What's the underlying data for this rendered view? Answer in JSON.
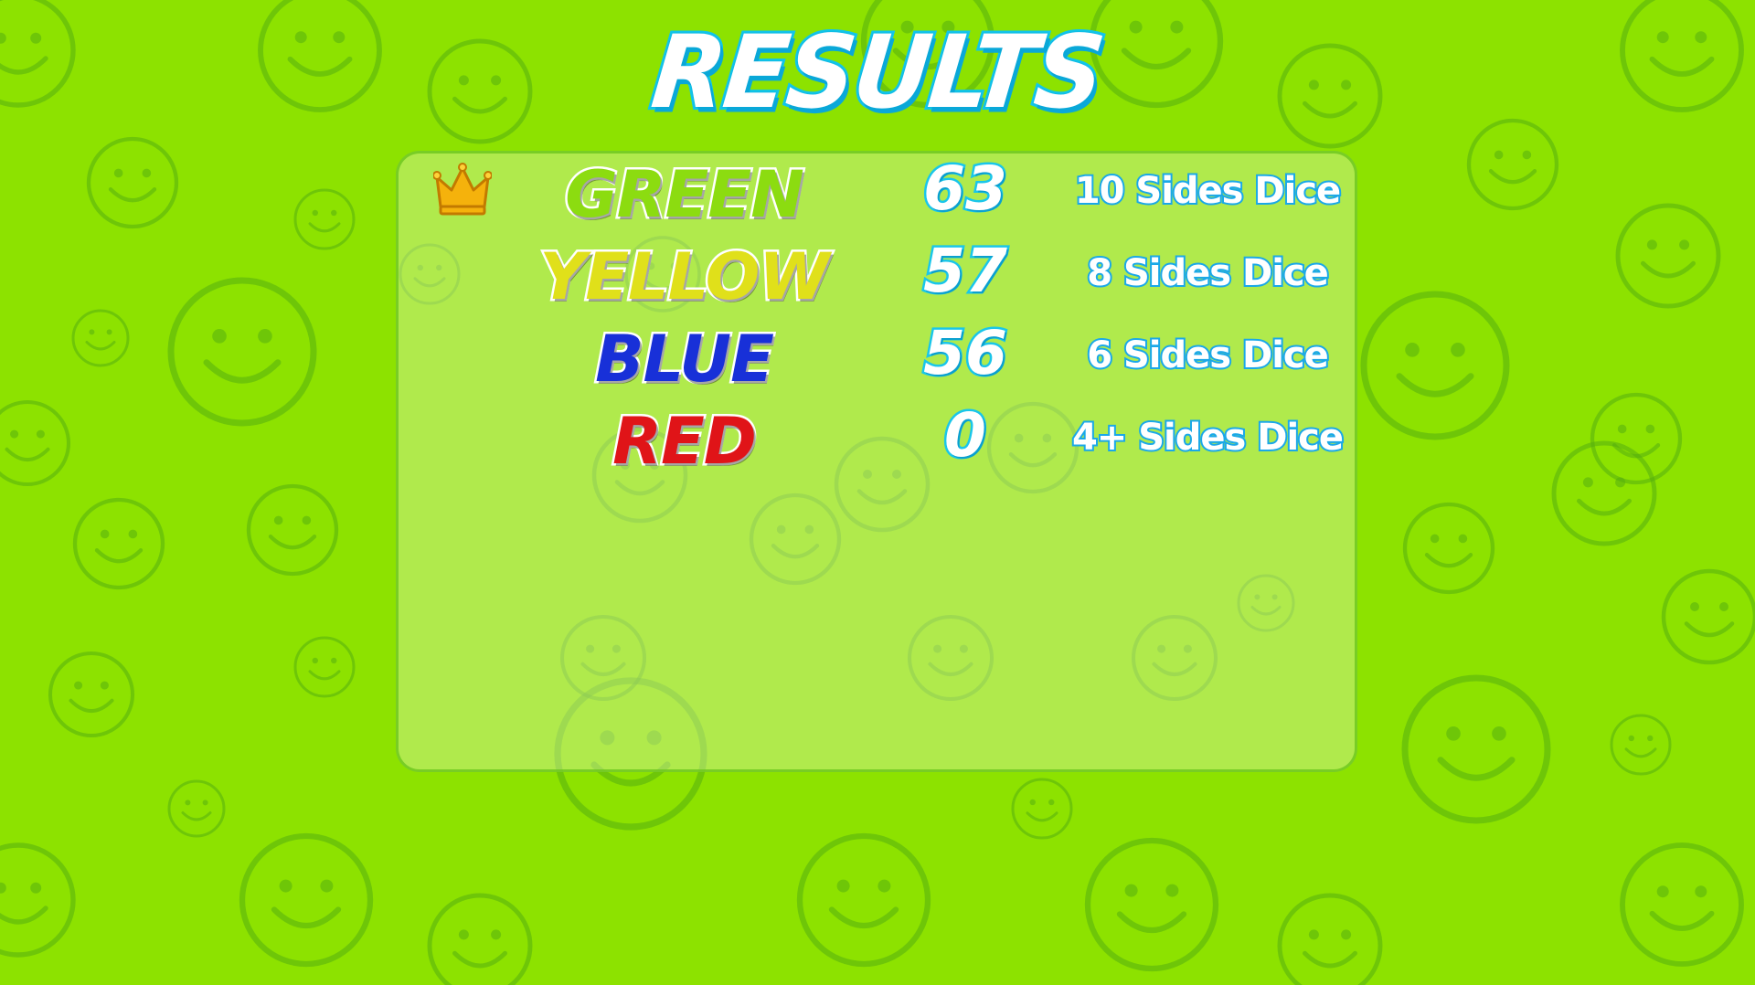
{
  "title": "RESULTS",
  "rows": [
    {
      "team": "GREEN",
      "team_color": "#8cdc10",
      "score": "63",
      "reward": "10 Sides Dice",
      "winner": true
    },
    {
      "team": "YELLOW",
      "team_color": "#e0e01a",
      "score": "57",
      "reward": "8 Sides Dice",
      "winner": false
    },
    {
      "team": "BLUE",
      "team_color": "#1830d8",
      "score": "56",
      "reward": "6 Sides Dice",
      "winner": false
    },
    {
      "team": "RED",
      "team_color": "#e01418",
      "score": "0",
      "reward": "4+ Sides Dice",
      "winner": false
    }
  ],
  "icons": {
    "winner": "crown-icon",
    "background": "smiley-face-icon"
  },
  "colors": {
    "background": "#8de200",
    "title_outline": "#12c6ea",
    "score_outline": "#19c6ea",
    "reward_outline": "#1aa8e8"
  }
}
